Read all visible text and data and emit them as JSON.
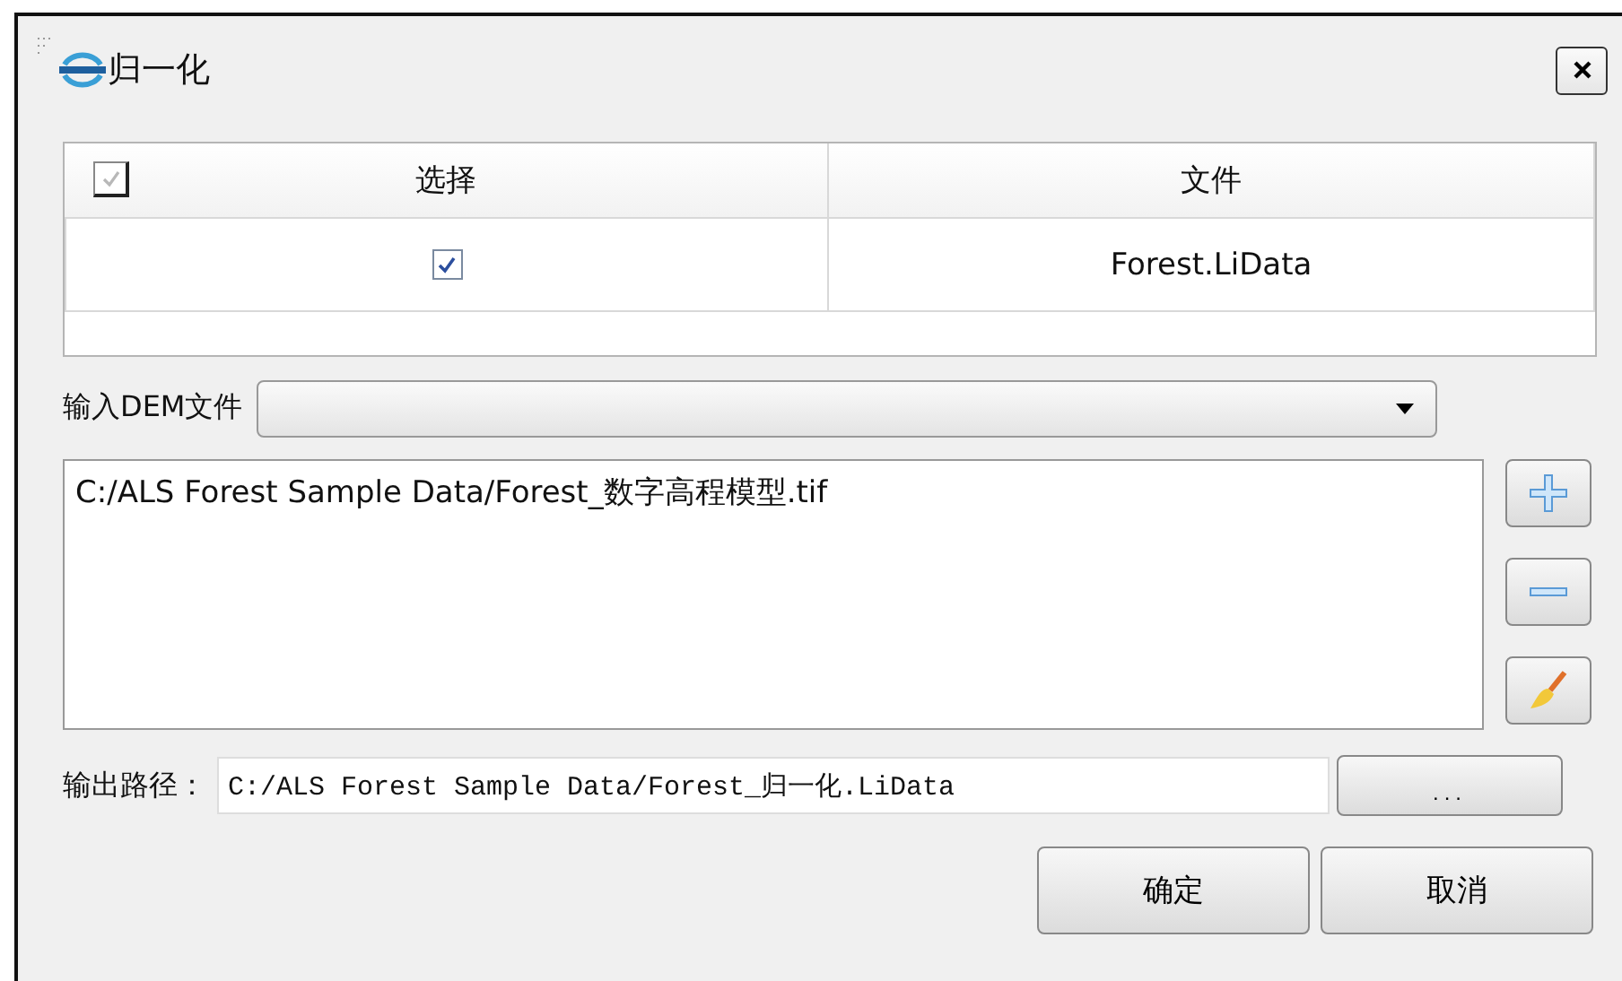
{
  "window": {
    "title": "归一化"
  },
  "table": {
    "header_checkbox": {
      "checked": true
    },
    "columns": [
      "选择",
      "文件"
    ],
    "rows": [
      {
        "checked": true,
        "file": "Forest.LiData"
      }
    ]
  },
  "dem": {
    "label": "输入DEM文件"
  },
  "dem_files": [
    "C:/ALS Forest Sample Data/Forest_数字高程模型.tif"
  ],
  "output": {
    "label": "输出路径：",
    "value": "C:/ALS Forest Sample Data/Forest_归一化.LiData",
    "browse": "..."
  },
  "buttons": [
    "确定",
    "取消"
  ]
}
